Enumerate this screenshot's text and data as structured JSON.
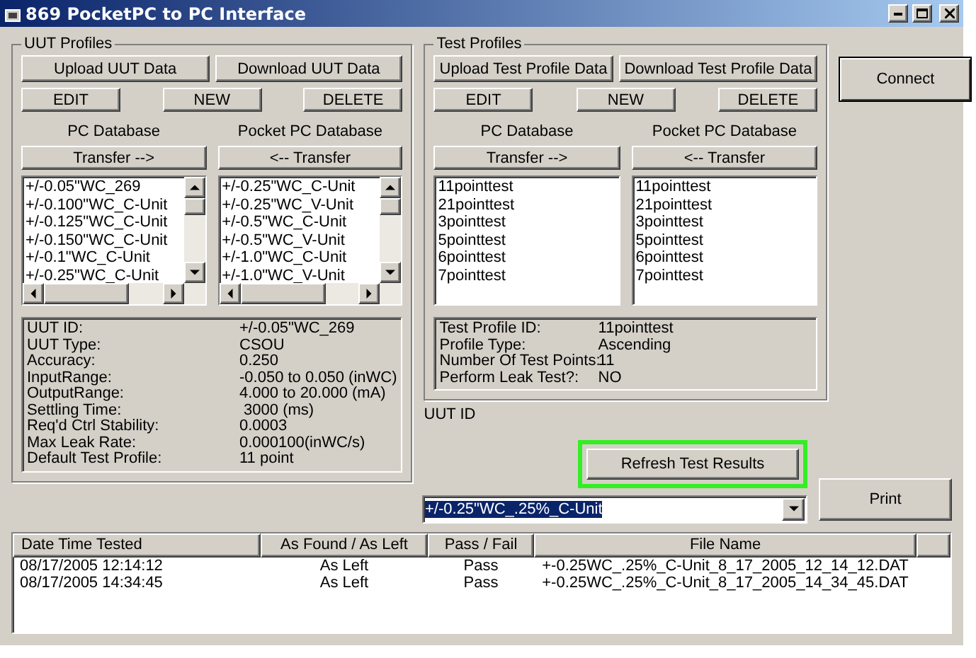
{
  "window": {
    "title": "869 PocketPC to PC Interface"
  },
  "uut_profiles": {
    "title": "UUT Profiles",
    "upload": "Upload UUT Data",
    "download": "Download UUT Data",
    "actions": [
      "EDIT",
      "NEW",
      "DELETE"
    ],
    "databases": [
      {
        "heading": "PC Database",
        "transfer": "Transfer -->",
        "scrollbars": true,
        "items": [
          "+/-0.05\"WC_269",
          "+/-0.100\"WC_C-Unit",
          "+/-0.125\"WC_C-Unit",
          "+/-0.150\"WC_C-Unit",
          "+/-0.1\"WC_C-Unit",
          "+/-0.25\"WC_C-Unit"
        ]
      },
      {
        "heading": "Pocket PC Database",
        "transfer": "<-- Transfer",
        "scrollbars": true,
        "items": [
          "+/-0.25\"WC_C-Unit",
          "+/-0.25\"WC_V-Unit",
          "+/-0.5\"WC_C-Unit",
          "+/-0.5\"WC_V-Unit",
          "+/-1.0\"WC_C-Unit",
          "+/-1.0\"WC_V-Unit"
        ]
      }
    ],
    "details": [
      {
        "label": "UUT ID:",
        "value": "+/-0.05\"WC_269"
      },
      {
        "label": "UUT Type:",
        "value": "CSOU"
      },
      {
        "label": "Accuracy:",
        "value": "0.250"
      },
      {
        "label": "InputRange:",
        "value": "-0.050 to 0.050 (inWC)"
      },
      {
        "label": "OutputRange:",
        "value": "4.000 to 20.000 (mA)"
      },
      {
        "label": "Settling Time:",
        "value": " 3000 (ms)"
      },
      {
        "label": "Req'd Ctrl Stability:",
        "value": "0.0003"
      },
      {
        "label": "Max Leak Rate:",
        "value": "0.000100(inWC/s)"
      },
      {
        "label": "Default Test Profile:",
        "value": "11 point"
      }
    ]
  },
  "test_profiles": {
    "title": "Test Profiles",
    "upload": "Upload Test Profile Data",
    "download": "Download Test Profile Data",
    "actions": [
      "EDIT",
      "NEW",
      "DELETE"
    ],
    "databases": [
      {
        "heading": "PC Database",
        "transfer": "Transfer -->",
        "scrollbars": false,
        "items": [
          "11pointtest",
          "21pointtest",
          "3pointtest",
          "5pointtest",
          "6pointtest",
          "7pointtest"
        ]
      },
      {
        "heading": "Pocket PC Database",
        "transfer": "<-- Transfer",
        "scrollbars": false,
        "items": [
          "11pointtest",
          "21pointtest",
          "3pointtest",
          "5pointtest",
          "6pointtest",
          "7pointtest"
        ]
      }
    ],
    "details": [
      {
        "label": "Test Profile ID:",
        "value": "11pointtest"
      },
      {
        "label": "Profile Type:",
        "value": "Ascending"
      },
      {
        "label": "Number Of Test Points:",
        "value": "11"
      },
      {
        "label": "Perform Leak Test?:",
        "value": "NO"
      }
    ]
  },
  "connect": "Connect",
  "uut_id": {
    "label": "UUT ID",
    "value": "+/-0.25\"WC_.25%_C-Unit",
    "text_selected": true
  },
  "refresh": {
    "label": "Refresh Test Results",
    "highlighted": true
  },
  "print": "Print",
  "results": {
    "columns": [
      "Date Time Tested",
      "As Found / As Left",
      "Pass / Fail",
      "File Name"
    ],
    "rows": [
      [
        "08/17/2005 12:14:12",
        "As Left",
        "Pass",
        "+-0.25WC_.25%_C-Unit_8_17_2005_12_14_12.DAT"
      ],
      [
        "08/17/2005 14:34:45",
        "As Left",
        "Pass",
        "+-0.25WC_.25%_C-Unit_8_17_2005_14_34_45.DAT"
      ]
    ]
  }
}
